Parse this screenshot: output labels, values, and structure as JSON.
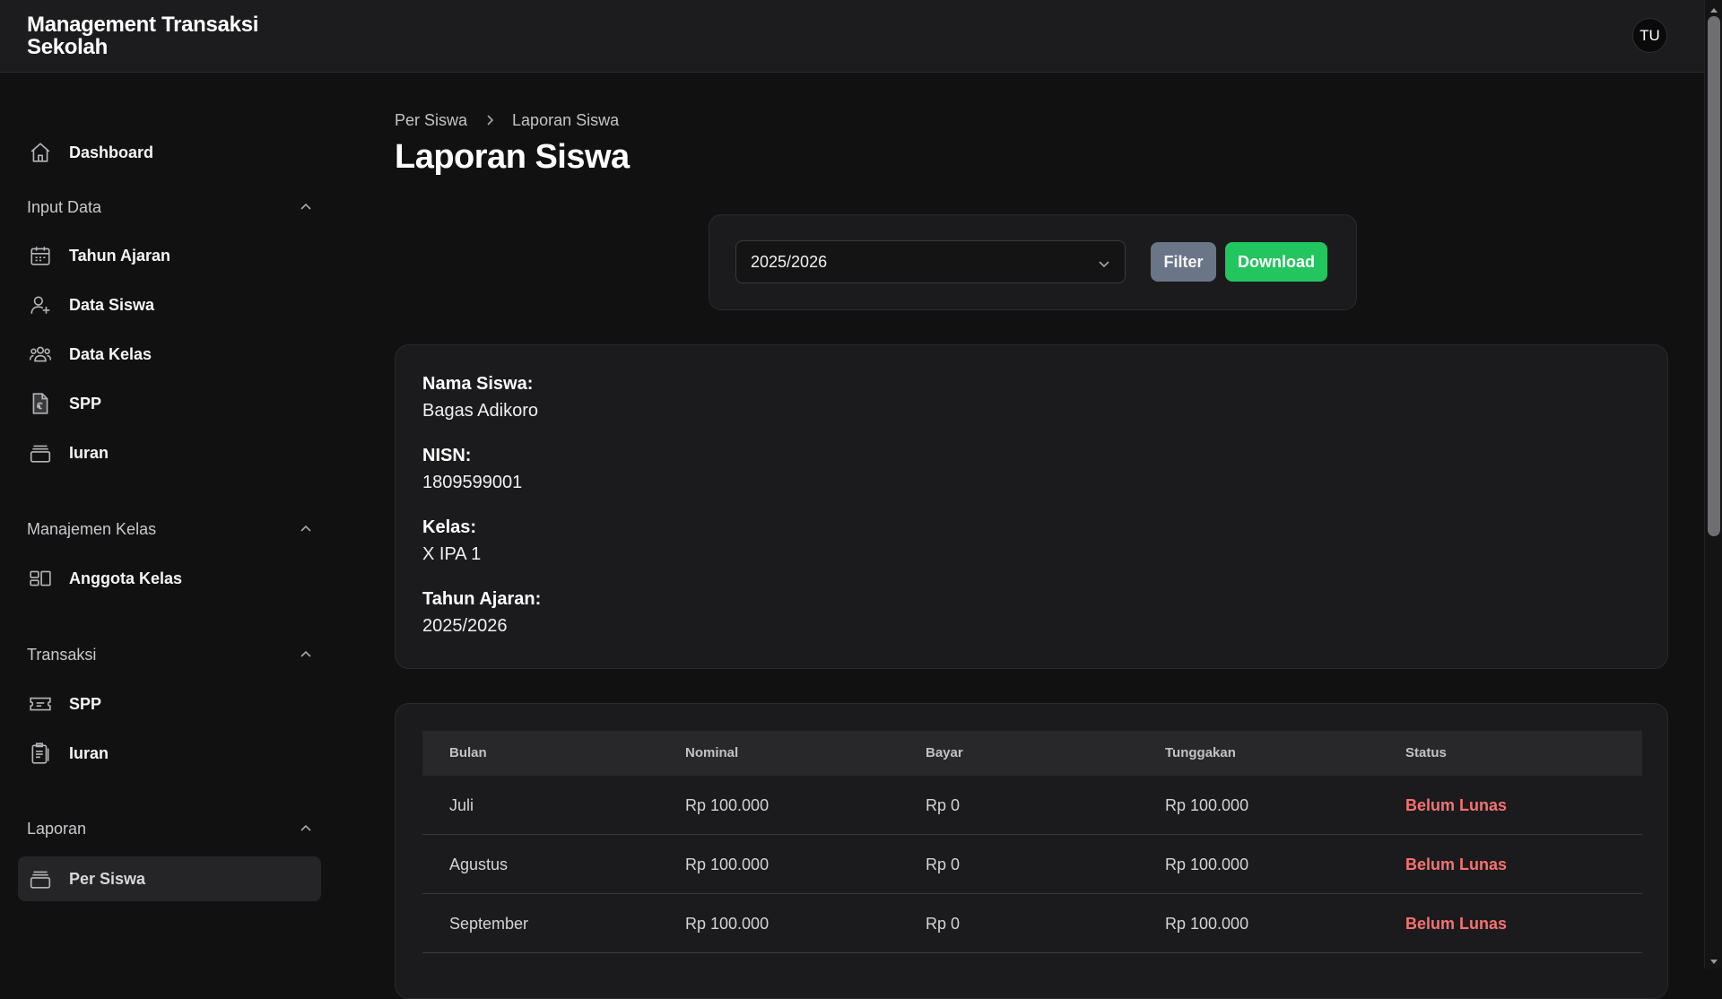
{
  "app": {
    "title": "Management Transaksi Sekolah",
    "avatar_initials": "TU"
  },
  "sidebar": {
    "dashboard": {
      "label": "Dashboard",
      "icon": "home-icon"
    },
    "sections": [
      {
        "title": "Input Data",
        "items": [
          {
            "label": "Tahun Ajaran",
            "icon": "calendar-icon"
          },
          {
            "label": "Data Siswa",
            "icon": "user-plus-icon"
          },
          {
            "label": "Data Kelas",
            "icon": "users-group-icon"
          },
          {
            "label": "SPP",
            "icon": "file-currency-icon"
          },
          {
            "label": "Iuran",
            "icon": "box-icon"
          }
        ]
      },
      {
        "title": "Manajemen Kelas",
        "items": [
          {
            "label": "Anggota Kelas",
            "icon": "layout-icon"
          }
        ]
      },
      {
        "title": "Transaksi",
        "items": [
          {
            "label": "SPP",
            "icon": "ticket-icon"
          },
          {
            "label": "Iuran",
            "icon": "clipboard-icon"
          }
        ]
      },
      {
        "title": "Laporan",
        "items": [
          {
            "label": "Per Siswa",
            "icon": "box-icon",
            "active": true
          }
        ]
      }
    ]
  },
  "breadcrumb": {
    "parent": "Per Siswa",
    "current": "Laporan Siswa"
  },
  "page_title": "Laporan Siswa",
  "filter": {
    "selected_year": "2025/2026",
    "filter_label": "Filter",
    "download_label": "Download",
    "filter_color": "#6b7588",
    "download_color": "#22c55e"
  },
  "student": {
    "name_label": "Nama Siswa:",
    "name": "Bagas Adikoro",
    "nisn_label": "NISN:",
    "nisn": "1809599001",
    "class_label": "Kelas:",
    "class": "X IPA 1",
    "year_label": "Tahun Ajaran:",
    "year": "2025/2026"
  },
  "table": {
    "headers": {
      "month": "Bulan",
      "nominal": "Nominal",
      "paid": "Bayar",
      "arrears": "Tunggakan",
      "status": "Status"
    },
    "rows": [
      {
        "month": "Juli",
        "nominal": "Rp 100.000",
        "paid": "Rp 0",
        "arrears": "Rp 100.000",
        "status": "Belum Lunas"
      },
      {
        "month": "Agustus",
        "nominal": "Rp 100.000",
        "paid": "Rp 0",
        "arrears": "Rp 100.000",
        "status": "Belum Lunas"
      },
      {
        "month": "September",
        "nominal": "Rp 100.000",
        "paid": "Rp 0",
        "arrears": "Rp 100.000",
        "status": "Belum Lunas"
      }
    ],
    "status_color": "#f87171"
  }
}
